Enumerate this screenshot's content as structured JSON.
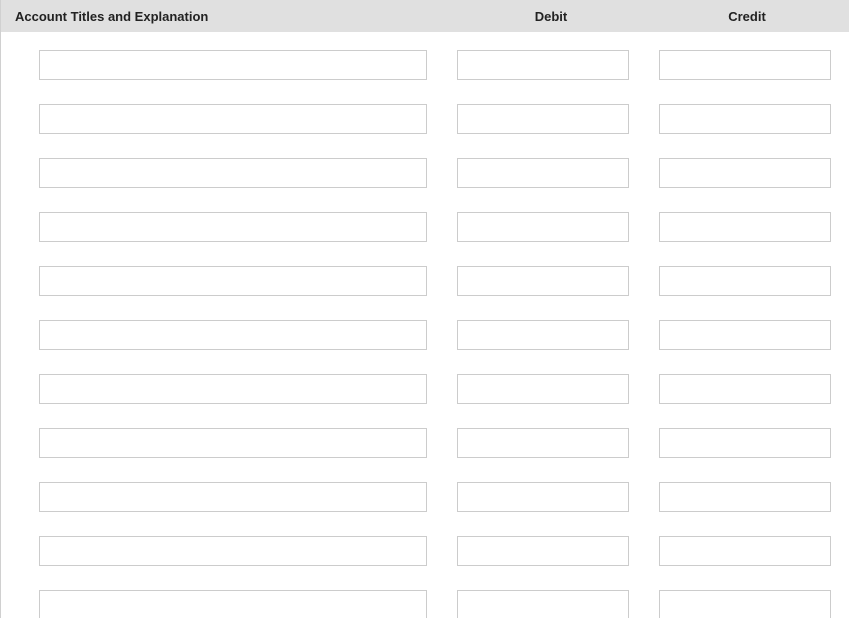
{
  "headers": {
    "account": "Account Titles and Explanation",
    "debit": "Debit",
    "credit": "Credit"
  },
  "rows": [
    {
      "account": "",
      "debit": "",
      "credit": ""
    },
    {
      "account": "",
      "debit": "",
      "credit": ""
    },
    {
      "account": "",
      "debit": "",
      "credit": ""
    },
    {
      "account": "",
      "debit": "",
      "credit": ""
    },
    {
      "account": "",
      "debit": "",
      "credit": ""
    },
    {
      "account": "",
      "debit": "",
      "credit": ""
    },
    {
      "account": "",
      "debit": "",
      "credit": ""
    },
    {
      "account": "",
      "debit": "",
      "credit": ""
    },
    {
      "account": "",
      "debit": "",
      "credit": ""
    },
    {
      "account": "",
      "debit": "",
      "credit": ""
    },
    {
      "account": "",
      "debit": "",
      "credit": ""
    }
  ]
}
